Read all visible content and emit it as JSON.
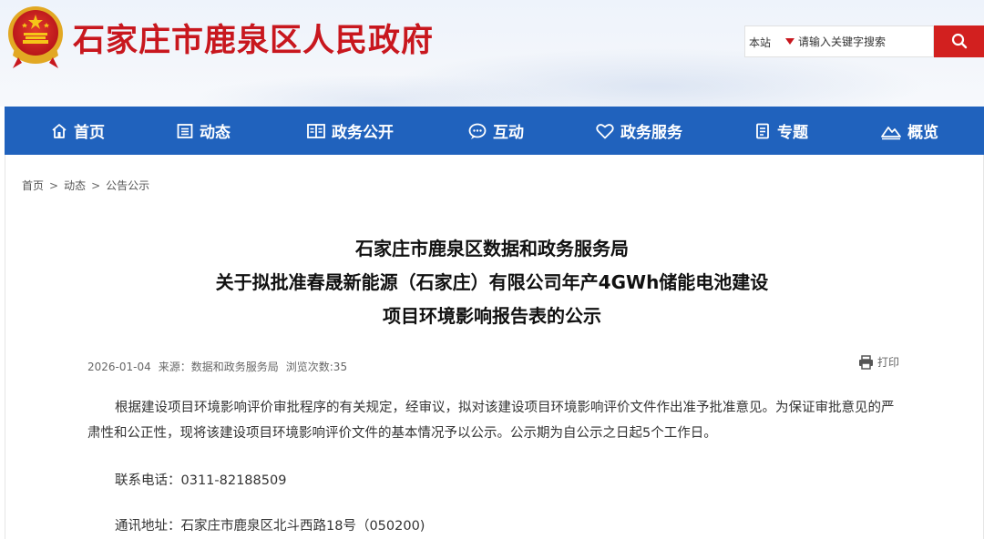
{
  "header": {
    "site_title": "石家庄市鹿泉区人民政府",
    "emblem_icon": "national-emblem-icon",
    "search": {
      "scope": "本站",
      "placeholder": "请输入关键字搜索",
      "button_icon": "search-icon"
    },
    "colors": {
      "title": "#c8171e",
      "search_button": "#d2201f"
    }
  },
  "nav": {
    "background": "#2062bd",
    "items": [
      {
        "label": "首页",
        "icon": "home-icon"
      },
      {
        "label": "动态",
        "icon": "news-icon"
      },
      {
        "label": "政务公开",
        "icon": "book-icon"
      },
      {
        "label": "互动",
        "icon": "chat-icon"
      },
      {
        "label": "政务服务",
        "icon": "heart-icon"
      },
      {
        "label": "专题",
        "icon": "document-icon"
      },
      {
        "label": "概览",
        "icon": "mountain-icon"
      }
    ]
  },
  "breadcrumb": {
    "items": [
      "首页",
      "动态",
      "公告公示"
    ],
    "separator": ">"
  },
  "article": {
    "title_lines": [
      "石家庄市鹿泉区数据和政务服务局",
      "关于拟批准春晟新能源（石家庄）有限公司年产4GWh储能电池建设",
      "项目环境影响报告表的公示"
    ],
    "date": "2026-01-04",
    "source": "来源：数据和政务服务局",
    "views": "浏览次数:35",
    "print_label": "打印",
    "paragraph": "根据建设项目环境影响评价审批程序的有关规定，经审议，拟对该建设项目环境影响评价文件作出准予批准意见。为保证审批意见的严肃性和公正性，现将该建设项目环境影响评价文件的基本情况予以公示。公示期为自公示之日起5个工作日。",
    "contact_phone": "联系电话：0311-82188509",
    "contact_address": "通讯地址：石家庄市鹿泉区北斗西路18号（050200)"
  }
}
